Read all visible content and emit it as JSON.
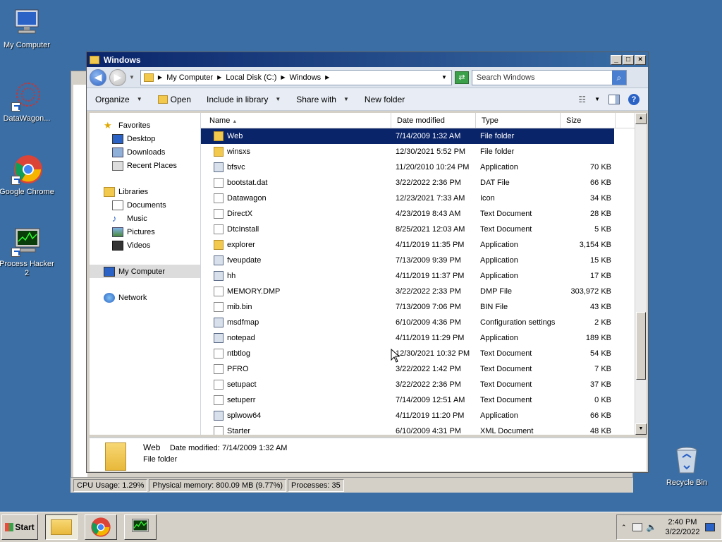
{
  "desktop": {
    "icons": [
      {
        "label": "My Computer"
      },
      {
        "label": "DataWagon..."
      },
      {
        "label": "Google Chrome"
      },
      {
        "label": "Process Hacker 2"
      },
      {
        "label": "Recycle Bin"
      }
    ]
  },
  "process_hacker": {
    "status_cpu": "CPU Usage: 1.29%",
    "status_mem": "Physical memory: 800.09 MB (9.77%)",
    "status_proc": "Processes: 35"
  },
  "window": {
    "title": "Windows",
    "controls": {
      "minimize": "_",
      "maximize": "□",
      "close": "×"
    }
  },
  "address": {
    "crumbs": [
      "My Computer",
      "Local Disk (C:)",
      "Windows"
    ],
    "search_placeholder": "Search Windows"
  },
  "commands": {
    "organize": "Organize",
    "open": "Open",
    "include": "Include in library",
    "share": "Share with",
    "new_folder": "New folder",
    "help": "?"
  },
  "nav": {
    "favorites": "Favorites",
    "desktop": "Desktop",
    "downloads": "Downloads",
    "recent": "Recent Places",
    "libraries": "Libraries",
    "documents": "Documents",
    "music": "Music",
    "pictures": "Pictures",
    "videos": "Videos",
    "my_computer": "My Computer",
    "network": "Network"
  },
  "columns": {
    "name": "Name",
    "date": "Date modified",
    "type": "Type",
    "size": "Size"
  },
  "files": [
    {
      "name": "Web",
      "date": "7/14/2009 1:32 AM",
      "type": "File folder",
      "size": "",
      "kind": "folder"
    },
    {
      "name": "winsxs",
      "date": "12/30/2021 5:52 PM",
      "type": "File folder",
      "size": "",
      "kind": "folder"
    },
    {
      "name": "bfsvc",
      "date": "11/20/2010 10:24 PM",
      "type": "Application",
      "size": "70 KB",
      "kind": "app"
    },
    {
      "name": "bootstat.dat",
      "date": "3/22/2022 2:36 PM",
      "type": "DAT File",
      "size": "66 KB",
      "kind": "file"
    },
    {
      "name": "Datawagon",
      "date": "12/23/2021 7:33 AM",
      "type": "Icon",
      "size": "34 KB",
      "kind": "file"
    },
    {
      "name": "DirectX",
      "date": "4/23/2019 8:43 AM",
      "type": "Text Document",
      "size": "28 KB",
      "kind": "file"
    },
    {
      "name": "DtcInstall",
      "date": "8/25/2021 12:03 AM",
      "type": "Text Document",
      "size": "5 KB",
      "kind": "file"
    },
    {
      "name": "explorer",
      "date": "4/11/2019 11:35 PM",
      "type": "Application",
      "size": "3,154 KB",
      "kind": "folder"
    },
    {
      "name": "fveupdate",
      "date": "7/13/2009 9:39 PM",
      "type": "Application",
      "size": "15 KB",
      "kind": "app"
    },
    {
      "name": "hh",
      "date": "4/11/2019 11:37 PM",
      "type": "Application",
      "size": "17 KB",
      "kind": "app"
    },
    {
      "name": "MEMORY.DMP",
      "date": "3/22/2022 2:33 PM",
      "type": "DMP File",
      "size": "303,972 KB",
      "kind": "file"
    },
    {
      "name": "mib.bin",
      "date": "7/13/2009 7:06 PM",
      "type": "BIN File",
      "size": "43 KB",
      "kind": "file"
    },
    {
      "name": "msdfmap",
      "date": "6/10/2009 4:36 PM",
      "type": "Configuration settings",
      "size": "2 KB",
      "kind": "app"
    },
    {
      "name": "notepad",
      "date": "4/11/2019 11:29 PM",
      "type": "Application",
      "size": "189 KB",
      "kind": "app"
    },
    {
      "name": "ntbtlog",
      "date": "12/30/2021 10:32 PM",
      "type": "Text Document",
      "size": "54 KB",
      "kind": "file"
    },
    {
      "name": "PFRO",
      "date": "3/22/2022 1:42 PM",
      "type": "Text Document",
      "size": "7 KB",
      "kind": "file"
    },
    {
      "name": "setupact",
      "date": "3/22/2022 2:36 PM",
      "type": "Text Document",
      "size": "37 KB",
      "kind": "file"
    },
    {
      "name": "setuperr",
      "date": "7/14/2009 12:51 AM",
      "type": "Text Document",
      "size": "0 KB",
      "kind": "file"
    },
    {
      "name": "splwow64",
      "date": "4/11/2019 11:20 PM",
      "type": "Application",
      "size": "66 KB",
      "kind": "app"
    },
    {
      "name": "Starter",
      "date": "6/10/2009 4:31 PM",
      "type": "XML Document",
      "size": "48 KB",
      "kind": "file"
    }
  ],
  "details": {
    "name": "Web",
    "modified_label": "Date modified:",
    "modified_value": "7/14/2009 1:32 AM",
    "type": "File folder"
  },
  "taskbar": {
    "start": "Start",
    "time": "2:40 PM",
    "date": "3/22/2022"
  }
}
